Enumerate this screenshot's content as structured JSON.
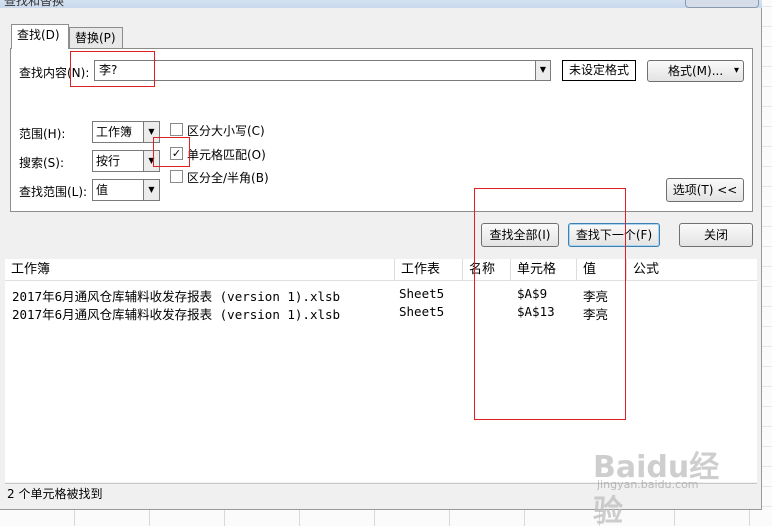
{
  "window": {
    "title": "查找和替换"
  },
  "tabs": [
    {
      "label": "查找(D)",
      "active": true
    },
    {
      "label": "替换(P)",
      "active": false
    }
  ],
  "find": {
    "label": "查找内容(N):",
    "value": "李?",
    "format_preview": "未设定格式",
    "format_button": "格式(M)...",
    "format_arrow": "▾"
  },
  "options": {
    "scope": {
      "label": "范围(H):",
      "value": "工作簿"
    },
    "search": {
      "label": "搜索(S):",
      "value": "按行"
    },
    "look_in": {
      "label": "查找范围(L):",
      "value": "值"
    },
    "match_case": {
      "label": "区分大小写(C)",
      "checked": false
    },
    "match_entire_cell": {
      "label": "单元格匹配(O)",
      "checked": true
    },
    "match_byte": {
      "label": "区分全/半角(B)",
      "checked": false
    },
    "options_button": "选项(T) <<"
  },
  "buttons": {
    "find_all": "查找全部(I)",
    "find_next": "查找下一个(F)",
    "close": "关闭"
  },
  "results": {
    "columns": [
      "工作簿",
      "工作表",
      "名称",
      "单元格",
      "值",
      "公式"
    ],
    "rows": [
      {
        "workbook": "2017年6月通风仓库辅料收发存报表 (version 1).xlsb",
        "sheet": "Sheet5",
        "name": "",
        "cell": "$A$9",
        "value": "李亮",
        "formula": ""
      },
      {
        "workbook": "2017年6月通风仓库辅料收发存报表 (version 1).xlsb",
        "sheet": "Sheet5",
        "name": "",
        "cell": "$A$13",
        "value": "李亮",
        "formula": ""
      }
    ]
  },
  "status": "2 个单元格被找到",
  "watermark": {
    "logo": "Baidu经验",
    "url": "jingyan.baidu.com"
  },
  "colors": {
    "highlight_box": "#e02020",
    "focus_border": "#3c7fb1"
  }
}
